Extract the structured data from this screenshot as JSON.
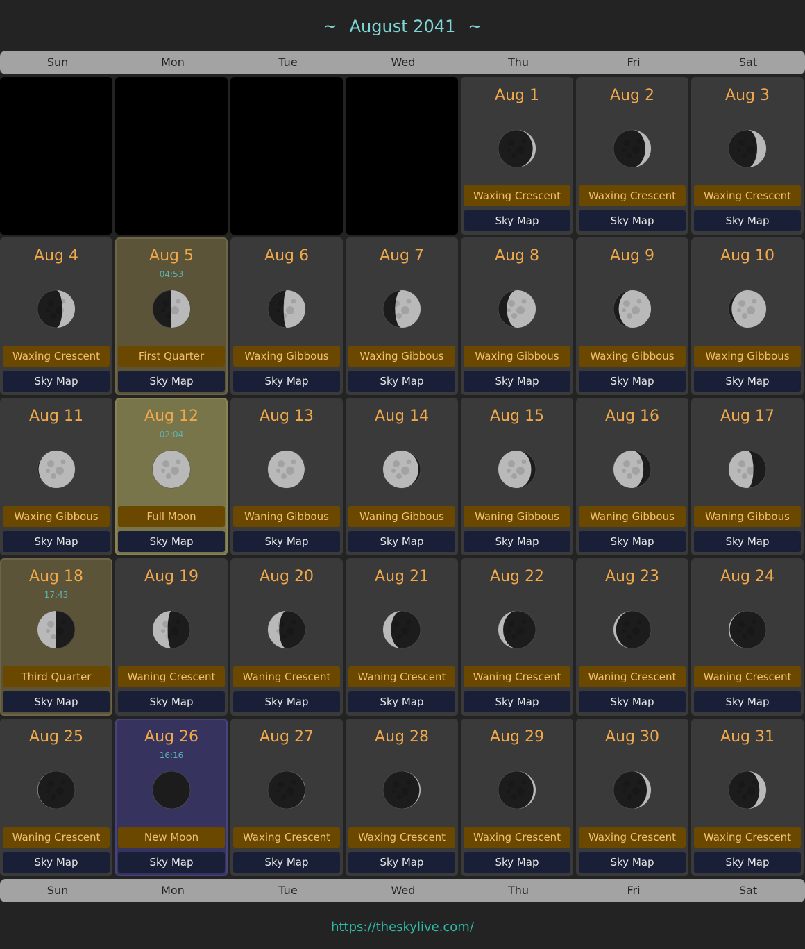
{
  "title": "August 2041",
  "title_deco": "~",
  "weekdays": [
    "Sun",
    "Mon",
    "Tue",
    "Wed",
    "Thu",
    "Fri",
    "Sat"
  ],
  "skymap_label": "Sky Map",
  "footer_link": "https://theskylive.com/",
  "colors": {
    "accent_date": "#f0a84a",
    "phase_bg": "#6b4800",
    "skymap_bg": "#1a1f38",
    "highlight_quarter": "#5c5438",
    "highlight_full": "#79754b",
    "highlight_new": "#36345f"
  },
  "leading_empty_days": 4,
  "days": [
    {
      "date": "Aug 1",
      "phase": "Waxing Crescent",
      "illum": 0.08,
      "waxing": true
    },
    {
      "date": "Aug 2",
      "phase": "Waxing Crescent",
      "illum": 0.15,
      "waxing": true
    },
    {
      "date": "Aug 3",
      "phase": "Waxing Crescent",
      "illum": 0.24,
      "waxing": true
    },
    {
      "date": "Aug 4",
      "phase": "Waxing Crescent",
      "illum": 0.34,
      "waxing": true
    },
    {
      "date": "Aug 5",
      "time": "04:53",
      "phase": "First Quarter",
      "illum": 0.5,
      "waxing": true,
      "highlight": "quarter"
    },
    {
      "date": "Aug 6",
      "phase": "Waxing Gibbous",
      "illum": 0.58,
      "waxing": true
    },
    {
      "date": "Aug 7",
      "phase": "Waxing Gibbous",
      "illum": 0.68,
      "waxing": true
    },
    {
      "date": "Aug 8",
      "phase": "Waxing Gibbous",
      "illum": 0.77,
      "waxing": true
    },
    {
      "date": "Aug 9",
      "phase": "Waxing Gibbous",
      "illum": 0.86,
      "waxing": true
    },
    {
      "date": "Aug 10",
      "phase": "Waxing Gibbous",
      "illum": 0.92,
      "waxing": true
    },
    {
      "date": "Aug 11",
      "phase": "Waxing Gibbous",
      "illum": 0.97,
      "waxing": true
    },
    {
      "date": "Aug 12",
      "time": "02:04",
      "phase": "Full Moon",
      "illum": 1.0,
      "waxing": true,
      "highlight": "full"
    },
    {
      "date": "Aug 13",
      "phase": "Waning Gibbous",
      "illum": 0.98,
      "waxing": false
    },
    {
      "date": "Aug 14",
      "phase": "Waning Gibbous",
      "illum": 0.94,
      "waxing": false
    },
    {
      "date": "Aug 15",
      "phase": "Waning Gibbous",
      "illum": 0.88,
      "waxing": false
    },
    {
      "date": "Aug 16",
      "phase": "Waning Gibbous",
      "illum": 0.8,
      "waxing": false
    },
    {
      "date": "Aug 17",
      "phase": "Waning Gibbous",
      "illum": 0.66,
      "waxing": false
    },
    {
      "date": "Aug 18",
      "time": "17:43",
      "phase": "Third Quarter",
      "illum": 0.5,
      "waxing": false,
      "highlight": "quarter"
    },
    {
      "date": "Aug 19",
      "phase": "Waning Crescent",
      "illum": 0.4,
      "waxing": false
    },
    {
      "date": "Aug 20",
      "phase": "Waning Crescent",
      "illum": 0.3,
      "waxing": false
    },
    {
      "date": "Aug 21",
      "phase": "Waning Crescent",
      "illum": 0.21,
      "waxing": false
    },
    {
      "date": "Aug 22",
      "phase": "Waning Crescent",
      "illum": 0.13,
      "waxing": false
    },
    {
      "date": "Aug 23",
      "phase": "Waning Crescent",
      "illum": 0.07,
      "waxing": false
    },
    {
      "date": "Aug 24",
      "phase": "Waning Crescent",
      "illum": 0.03,
      "waxing": false
    },
    {
      "date": "Aug 25",
      "phase": "Waning Crescent",
      "illum": 0.01,
      "waxing": false
    },
    {
      "date": "Aug 26",
      "time": "16:16",
      "phase": "New Moon",
      "illum": 0.0,
      "waxing": true,
      "highlight": "new"
    },
    {
      "date": "Aug 27",
      "phase": "Waxing Crescent",
      "illum": 0.01,
      "waxing": true
    },
    {
      "date": "Aug 28",
      "phase": "Waxing Crescent",
      "illum": 0.03,
      "waxing": true
    },
    {
      "date": "Aug 29",
      "phase": "Waxing Crescent",
      "illum": 0.06,
      "waxing": true
    },
    {
      "date": "Aug 30",
      "phase": "Waxing Crescent",
      "illum": 0.11,
      "waxing": true
    },
    {
      "date": "Aug 31",
      "phase": "Waxing Crescent",
      "illum": 0.18,
      "waxing": true
    }
  ]
}
